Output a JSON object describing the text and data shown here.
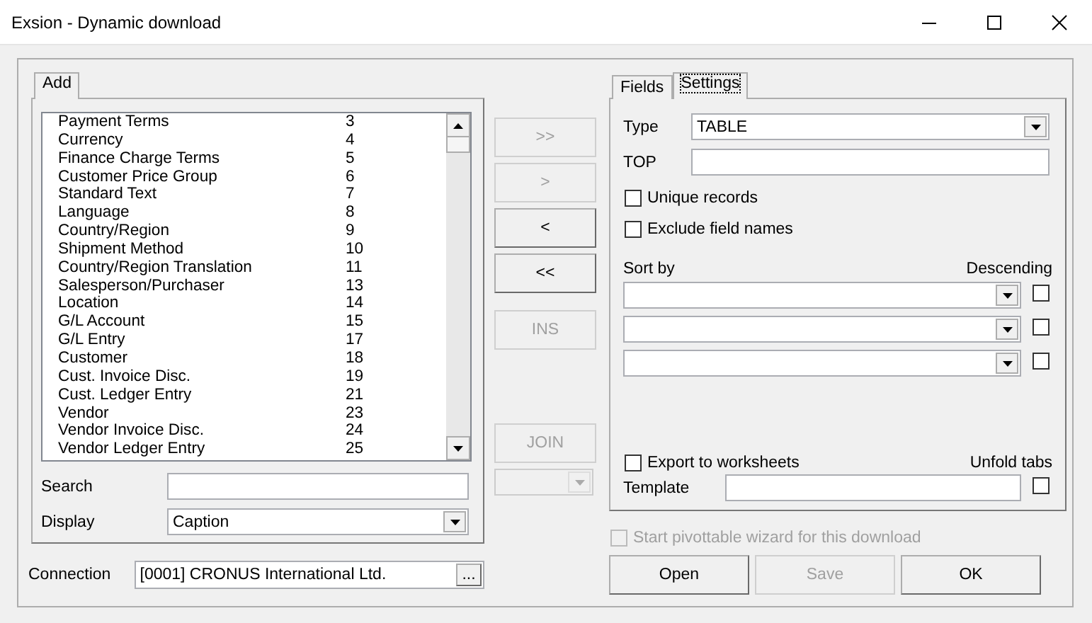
{
  "window": {
    "title": "Exsion - Dynamic download"
  },
  "add_panel": {
    "tabs": [
      {
        "label": "Add",
        "selected": true
      }
    ],
    "tables": [
      {
        "name": "Payment Terms",
        "number": "3"
      },
      {
        "name": "Currency",
        "number": "4"
      },
      {
        "name": "Finance Charge Terms",
        "number": "5"
      },
      {
        "name": "Customer Price Group",
        "number": "6"
      },
      {
        "name": "Standard Text",
        "number": "7"
      },
      {
        "name": "Language",
        "number": "8"
      },
      {
        "name": "Country/Region",
        "number": "9"
      },
      {
        "name": "Shipment Method",
        "number": "10"
      },
      {
        "name": "Country/Region Translation",
        "number": "11"
      },
      {
        "name": "Salesperson/Purchaser",
        "number": "13"
      },
      {
        "name": "Location",
        "number": "14"
      },
      {
        "name": "G/L Account",
        "number": "15"
      },
      {
        "name": "G/L Entry",
        "number": "17"
      },
      {
        "name": "Customer",
        "number": "18"
      },
      {
        "name": "Cust. Invoice Disc.",
        "number": "19"
      },
      {
        "name": "Cust. Ledger Entry",
        "number": "21"
      },
      {
        "name": "Vendor",
        "number": "23"
      },
      {
        "name": "Vendor Invoice Disc.",
        "number": "24"
      },
      {
        "name": "Vendor Ledger Entry",
        "number": "25"
      }
    ],
    "search": {
      "label": "Search"
    },
    "display": {
      "label": "Display",
      "value": "Caption"
    }
  },
  "connection": {
    "label": "Connection",
    "value": "[0001] CRONUS International Ltd.",
    "button": "..."
  },
  "transfer_buttons": [
    {
      "label": ">>",
      "disabled": true
    },
    {
      "label": ">",
      "disabled": true
    },
    {
      "label": "<",
      "disabled": false
    },
    {
      "label": "<<",
      "disabled": false
    },
    {
      "label": "INS",
      "disabled": true
    }
  ],
  "join": {
    "label": "JOIN",
    "disabled": true,
    "combo_disabled": true
  },
  "settings_panel": {
    "tabs": [
      {
        "label": "Fields",
        "selected": false
      },
      {
        "label": "Settings",
        "selected": true
      }
    ],
    "type": {
      "label": "Type",
      "value": "TABLE"
    },
    "top": {
      "label": "TOP"
    },
    "options": [
      {
        "label": "Unique records",
        "checked": false
      },
      {
        "label": "Exclude field names",
        "checked": false
      }
    ],
    "sort": {
      "label": "Sort by",
      "descending_label": "Descending",
      "rows": [
        {
          "descending": false
        },
        {
          "descending": false
        },
        {
          "descending": false
        }
      ]
    },
    "export": {
      "label": "Export to worksheets",
      "checked": false
    },
    "unfold": {
      "label": "Unfold tabs",
      "checked": false
    },
    "template": {
      "label": "Template"
    }
  },
  "pivot": {
    "label": "Start pivottable wizard for this download",
    "checked": false,
    "disabled": true
  },
  "buttons": [
    {
      "label": "Open",
      "disabled": false
    },
    {
      "label": "Save",
      "disabled": true
    },
    {
      "label": "OK",
      "disabled": false
    }
  ]
}
